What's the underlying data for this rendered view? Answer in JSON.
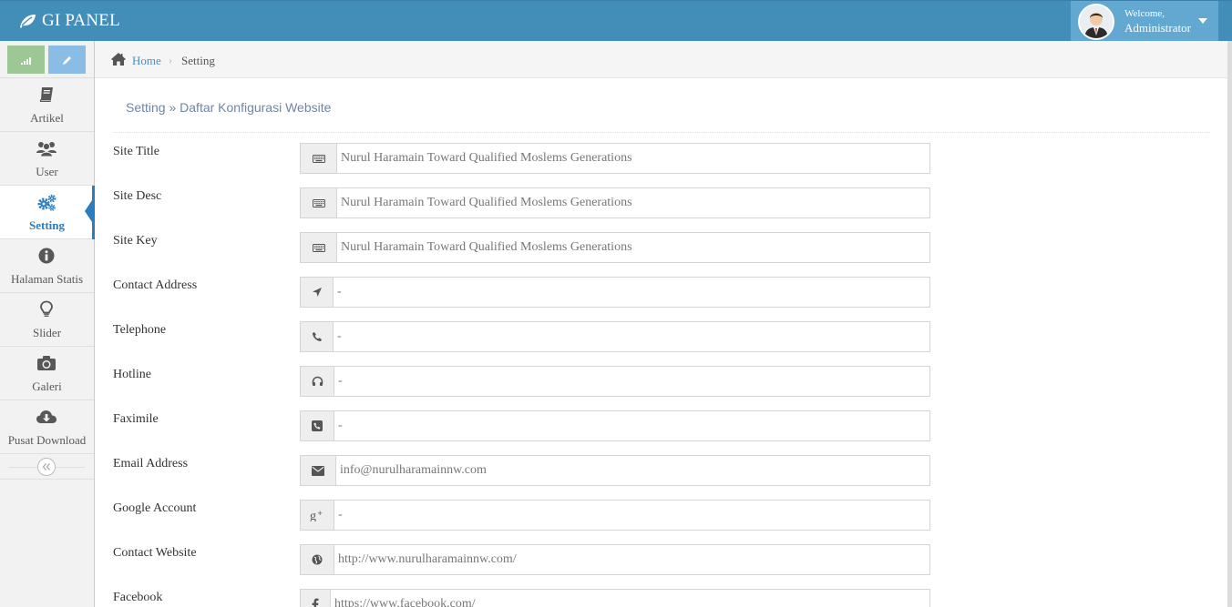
{
  "app": {
    "brand": "GI PANEL"
  },
  "user": {
    "welcome": "Welcome,",
    "name": "Administrator"
  },
  "sidebar": {
    "items": [
      {
        "label": "Artikel",
        "icon": "book-icon"
      },
      {
        "label": "User",
        "icon": "users-icon"
      },
      {
        "label": "Setting",
        "icon": "cogs-icon",
        "active": true
      },
      {
        "label": "Halaman Statis",
        "icon": "info-circle-icon"
      },
      {
        "label": "Slider",
        "icon": "lightbulb-icon"
      },
      {
        "label": "Galeri",
        "icon": "camera-icon"
      },
      {
        "label": "Pusat Download",
        "icon": "cloud-download-icon"
      }
    ]
  },
  "breadcrumb": {
    "home": "Home",
    "separator": "›",
    "current": "Setting"
  },
  "page": {
    "title": "Setting » Daftar Konfigurasi Website"
  },
  "form": {
    "fields": [
      {
        "label": "Site Title",
        "icon": "keyboard-icon",
        "value": "Nurul Haramain Toward Qualified Moslems Generations"
      },
      {
        "label": "Site Desc",
        "icon": "keyboard-icon",
        "value": "Nurul Haramain Toward Qualified Moslems Generations"
      },
      {
        "label": "Site Key",
        "icon": "keyboard-icon",
        "value": "Nurul Haramain Toward Qualified Moslems Generations"
      },
      {
        "label": "Contact Address",
        "icon": "location-arrow-icon",
        "value": "-"
      },
      {
        "label": "Telephone",
        "icon": "phone-icon",
        "value": "-"
      },
      {
        "label": "Hotline",
        "icon": "headphones-icon",
        "value": "-"
      },
      {
        "label": "Faximile",
        "icon": "phone-square-icon",
        "value": "-"
      },
      {
        "label": "Email Address",
        "icon": "envelope-icon",
        "value": "info@nurulharamainnw.com"
      },
      {
        "label": "Google Account",
        "icon": "google-plus-icon",
        "value": "-"
      },
      {
        "label": "Contact Website",
        "icon": "globe-icon",
        "value": "http://www.nurulharamainnw.com/"
      },
      {
        "label": "Facebook",
        "icon": "facebook-icon",
        "value": "https://www.facebook.com/"
      }
    ]
  },
  "colors": {
    "navbar": "#438eb9",
    "user_box": "#62a8d1",
    "active_accent": "#2b7dbc",
    "shortcut_green": "#9ec796",
    "shortcut_blue": "#89bde5"
  }
}
